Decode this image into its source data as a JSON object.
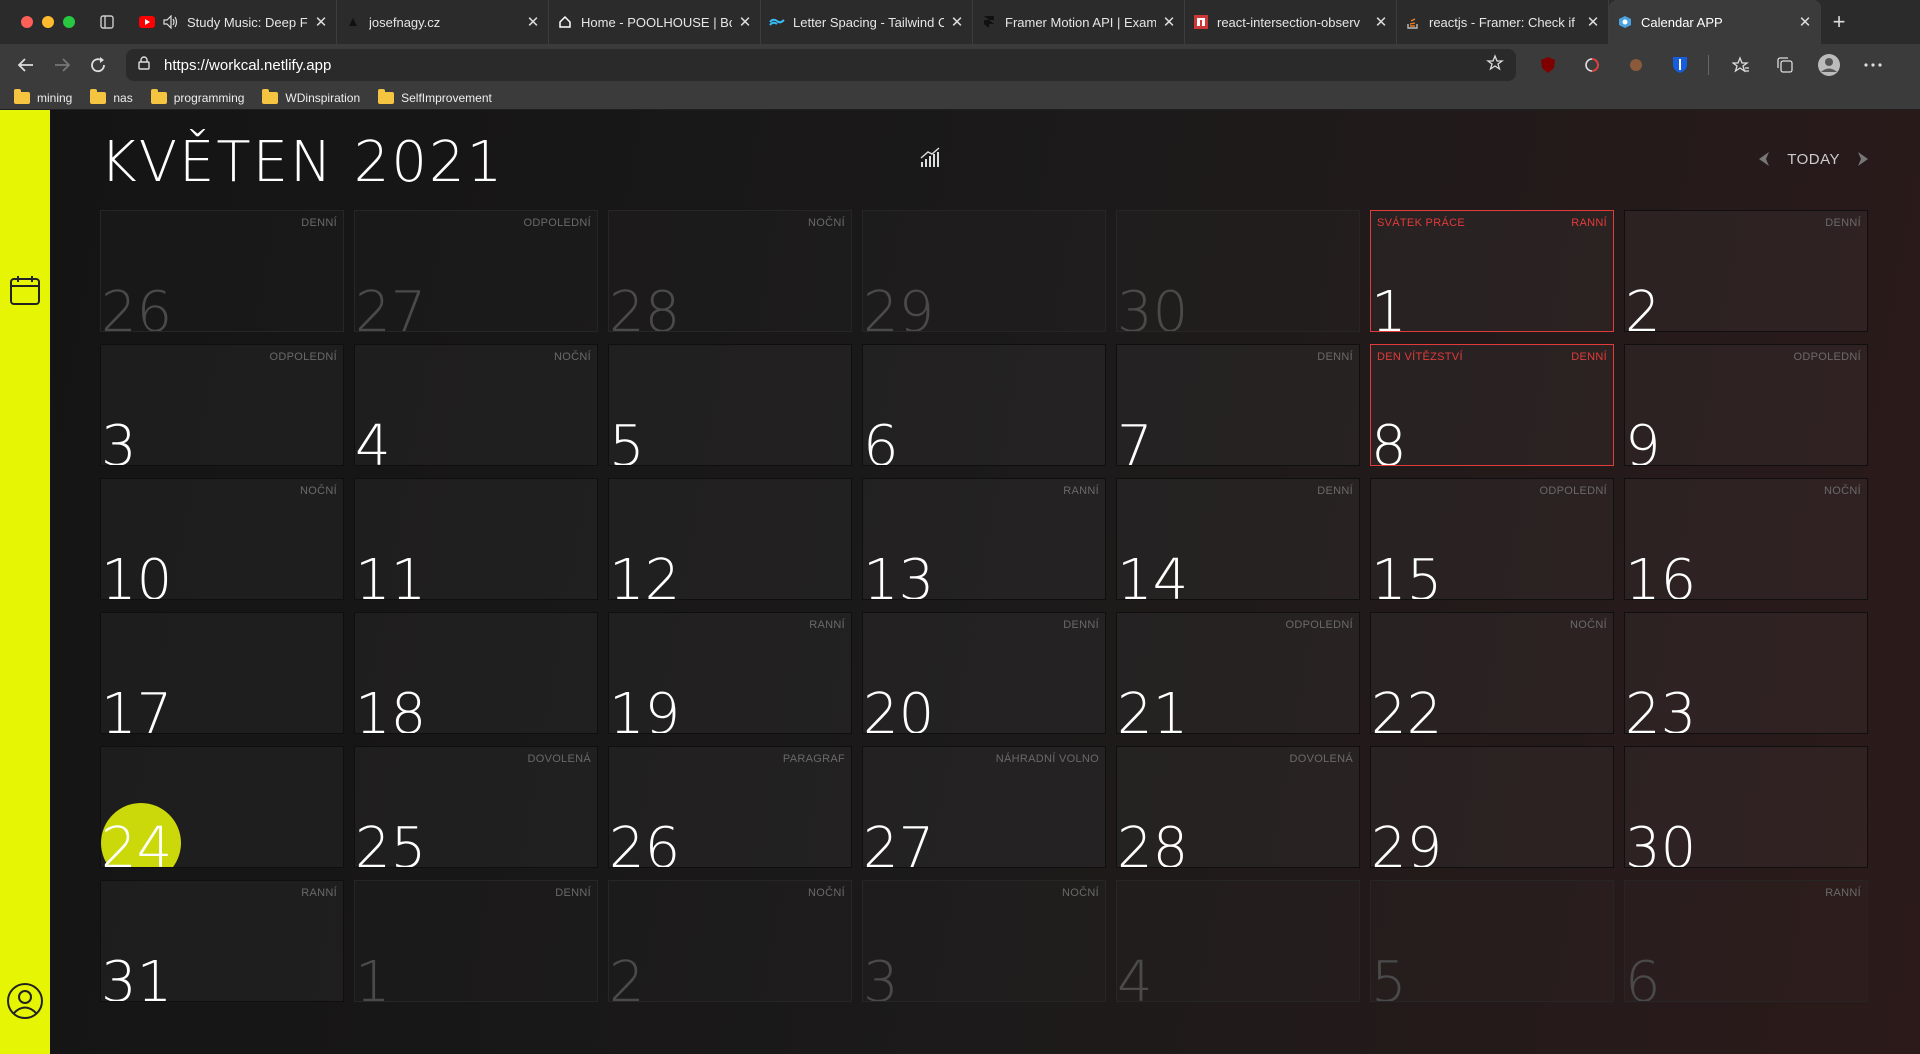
{
  "browser": {
    "tabs": [
      {
        "title": "Study Music: Deep Fo",
        "icon": "youtube-icon",
        "audio": true
      },
      {
        "title": "josefnagy.cz",
        "icon": "site-icon"
      },
      {
        "title": "Home - POOLHOUSE | Bo",
        "icon": "home-icon"
      },
      {
        "title": "Letter Spacing - Tailwind C",
        "icon": "tailwind-icon"
      },
      {
        "title": "Framer Motion API | Examp",
        "icon": "framer-icon"
      },
      {
        "title": "react-intersection-observ",
        "icon": "npm-icon"
      },
      {
        "title": "reactjs - Framer: Check if",
        "icon": "stackoverflow-icon"
      },
      {
        "title": "Calendar APP",
        "icon": "app-icon",
        "active": true
      }
    ],
    "url": "https://workcal.netlify.app",
    "bookmarks": [
      "mining",
      "nas",
      "programming",
      "WDinspiration",
      "SelfImprovement"
    ]
  },
  "calendar": {
    "title": "KVĚTEN 2021",
    "today_label": "TODAY",
    "accent": "#e6f503",
    "holiday_color": "#e23b3b",
    "days": [
      {
        "day": "26",
        "shift": "DENNÍ",
        "out": true
      },
      {
        "day": "27",
        "shift": "ODPOLEDNÍ",
        "out": true
      },
      {
        "day": "28",
        "shift": "NOČNÍ",
        "out": true
      },
      {
        "day": "29",
        "shift": "",
        "out": true
      },
      {
        "day": "30",
        "shift": "",
        "out": true
      },
      {
        "day": "1",
        "shift": "RANNÍ",
        "holiday": "SVÁTEK PRÁCE"
      },
      {
        "day": "2",
        "shift": "DENNÍ"
      },
      {
        "day": "3",
        "shift": "ODPOLEDNÍ"
      },
      {
        "day": "4",
        "shift": "NOČNÍ"
      },
      {
        "day": "5",
        "shift": ""
      },
      {
        "day": "6",
        "shift": ""
      },
      {
        "day": "7",
        "shift": "DENNÍ"
      },
      {
        "day": "8",
        "shift": "DENNÍ",
        "holiday": "DEN VÍTĚZSTVÍ"
      },
      {
        "day": "9",
        "shift": "ODPOLEDNÍ"
      },
      {
        "day": "10",
        "shift": "NOČNÍ"
      },
      {
        "day": "11",
        "shift": ""
      },
      {
        "day": "12",
        "shift": ""
      },
      {
        "day": "13",
        "shift": "RANNÍ"
      },
      {
        "day": "14",
        "shift": "DENNÍ"
      },
      {
        "day": "15",
        "shift": "ODPOLEDNÍ"
      },
      {
        "day": "16",
        "shift": "NOČNÍ"
      },
      {
        "day": "17",
        "shift": ""
      },
      {
        "day": "18",
        "shift": ""
      },
      {
        "day": "19",
        "shift": "RANNÍ"
      },
      {
        "day": "20",
        "shift": "DENNÍ"
      },
      {
        "day": "21",
        "shift": "ODPOLEDNÍ"
      },
      {
        "day": "22",
        "shift": "NOČNÍ"
      },
      {
        "day": "23",
        "shift": ""
      },
      {
        "day": "24",
        "shift": "",
        "today": true
      },
      {
        "day": "25",
        "shift": "DOVOLENÁ"
      },
      {
        "day": "26",
        "shift": "PARAGRAF"
      },
      {
        "day": "27",
        "shift": "NÁHRADNÍ VOLNO"
      },
      {
        "day": "28",
        "shift": "DOVOLENÁ"
      },
      {
        "day": "29",
        "shift": ""
      },
      {
        "day": "30",
        "shift": ""
      },
      {
        "day": "31",
        "shift": "RANNÍ"
      },
      {
        "day": "1",
        "shift": "DENNÍ",
        "out": true
      },
      {
        "day": "2",
        "shift": "NOČNÍ",
        "out": true
      },
      {
        "day": "3",
        "shift": "NOČNÍ",
        "out": true
      },
      {
        "day": "4",
        "shift": "",
        "out": true
      },
      {
        "day": "5",
        "shift": "",
        "out": true
      },
      {
        "day": "6",
        "shift": "RANNÍ",
        "out": true
      }
    ]
  }
}
